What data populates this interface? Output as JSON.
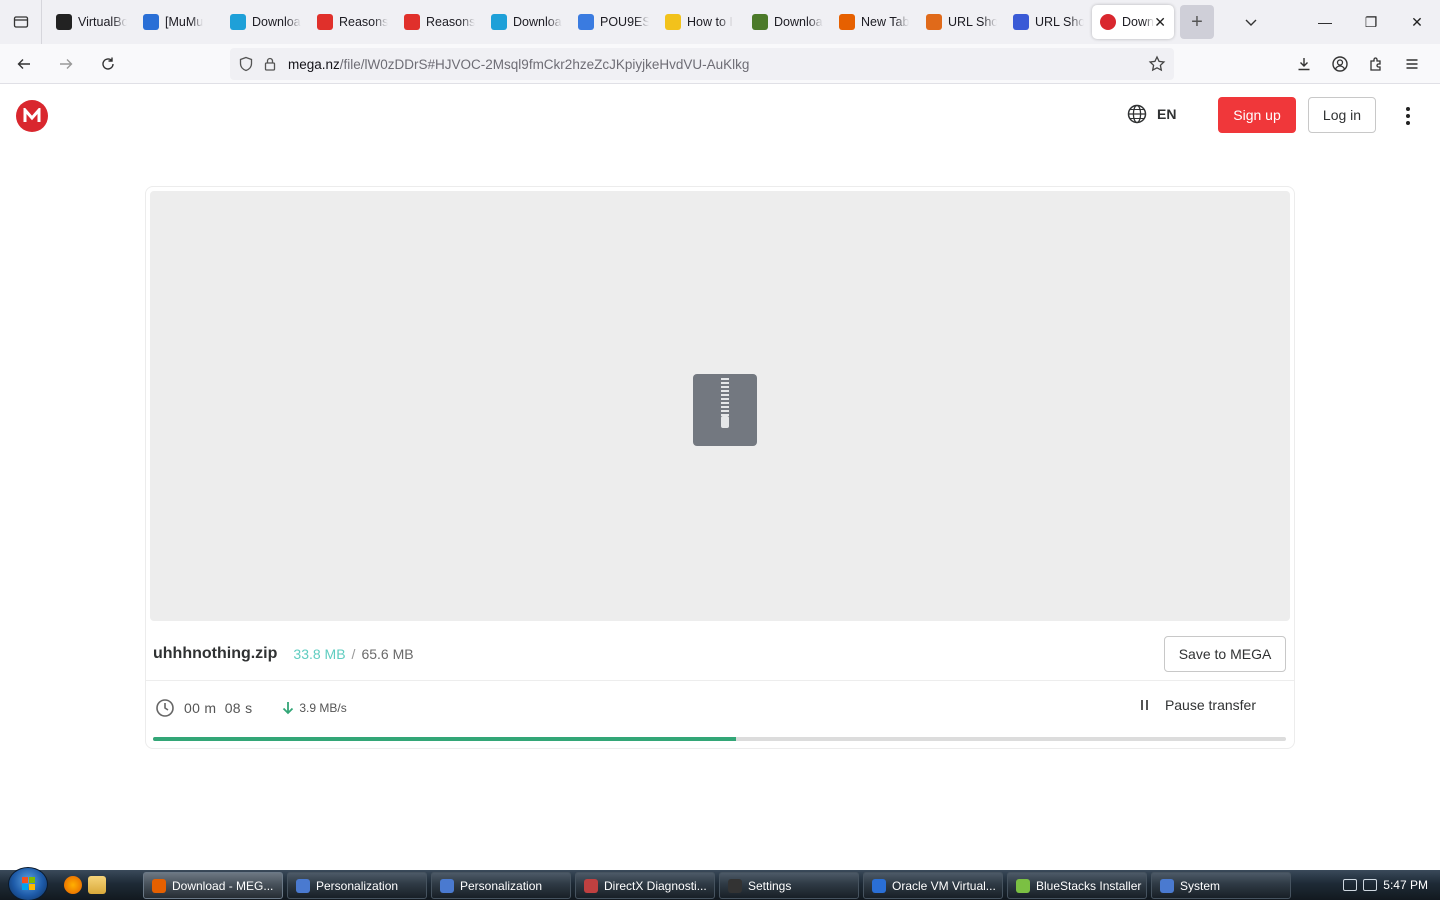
{
  "browser": {
    "tabs": [
      {
        "label": "VirtualBox",
        "color": "#222222"
      },
      {
        "label": "[MuMu",
        "color": "#2a6fd6"
      },
      {
        "label": "Download",
        "color": "#1ea0d8"
      },
      {
        "label": "Reasons",
        "color": "#e0302b"
      },
      {
        "label": "Reasons",
        "color": "#e0302b"
      },
      {
        "label": "Download",
        "color": "#1ea0d8"
      },
      {
        "label": "POU9ES",
        "color": "#3a7be0"
      },
      {
        "label": "How to I",
        "color": "#f2c21b"
      },
      {
        "label": "Download",
        "color": "#4c7a2a"
      },
      {
        "label": "New Tab",
        "color": "#e66000"
      },
      {
        "label": "URL Sho",
        "color": "#e06a1a"
      },
      {
        "label": "URL Sho",
        "color": "#3a5ad6"
      }
    ],
    "active_tab": {
      "label": "Down",
      "close": "✕",
      "color": "#d9272e"
    },
    "new_tab": "+",
    "url_host": "mega.nz",
    "url_path": "/file/lW0zDDrS#HJVOC-2Msql9fmCkr2hzeZcJKpiyjkeHvdVU-AuKlkg",
    "window_controls": {
      "minimize": "—",
      "restore": "❐",
      "close": "✕"
    }
  },
  "mega": {
    "logo_letter": "M",
    "brand_color": "#d9272e",
    "language": "EN",
    "signup_label": "Sign up",
    "login_label": "Log in",
    "file_name": "uhhhnothing.zip",
    "downloaded": "33.8 MB",
    "separator": "/",
    "total_size": "65.6 MB",
    "save_label": "Save to MEGA",
    "time_remaining": "00 m  08 s",
    "speed": "3.9 MB/s",
    "pause_label": "Pause transfer",
    "progress_percent": 51.5,
    "progress_color": "#33a677"
  },
  "taskbar": {
    "items": [
      {
        "label": "Download - MEG...",
        "active": true,
        "color": "#e66000"
      },
      {
        "label": "Personalization",
        "active": false,
        "color": "#4a7ad0"
      },
      {
        "label": "Personalization",
        "active": false,
        "color": "#4a7ad0"
      },
      {
        "label": "DirectX Diagnosti...",
        "active": false,
        "color": "#c04040"
      },
      {
        "label": "Settings",
        "active": false,
        "color": "#333333"
      },
      {
        "label": "Oracle VM Virtual...",
        "active": false,
        "color": "#2a6fd6"
      },
      {
        "label": "BlueStacks Installer",
        "active": false,
        "color": "#7bc043"
      },
      {
        "label": "System",
        "active": false,
        "color": "#4a7ad0"
      }
    ],
    "clock": "5:47 PM"
  }
}
